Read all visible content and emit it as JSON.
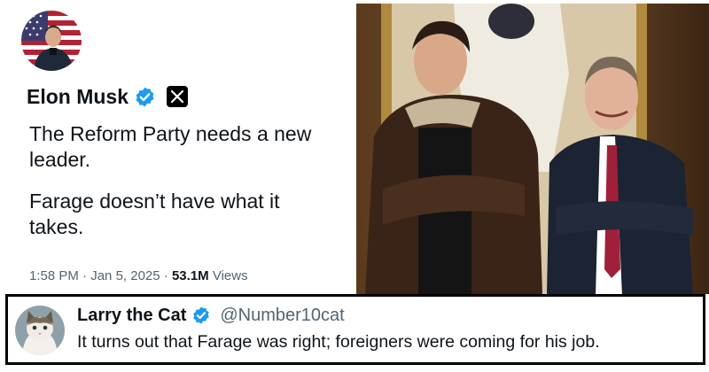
{
  "tweet": {
    "author_name": "Elon Musk",
    "badge_icon": "verified-icon",
    "platform_icon": "x-logo-icon",
    "text_paragraph_1": "The Reform Party needs a new leader.",
    "text_paragraph_2": "Farage doesn’t have what it takes.",
    "time": "1:58 PM",
    "separator": "·",
    "date": "Jan 5, 2025",
    "views_count": "53.1M",
    "views_label": "Views"
  },
  "reply": {
    "author_name": "Larry the Cat",
    "handle": "@Number10cat",
    "text": "It turns out that Farage was right; foreigners were coming for his job."
  },
  "colors": {
    "verified_blue": "#1d9bf0",
    "text_primary": "#0f1419",
    "text_secondary": "#536471"
  }
}
